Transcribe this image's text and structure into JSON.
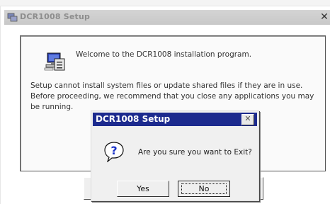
{
  "window": {
    "title": "DCR1008 Setup",
    "close_glyph": "✕"
  },
  "setup": {
    "welcome": "Welcome to the DCR1008 installation program.",
    "paragraph_line1": "Setup cannot install system files or update shared files if they are in use.",
    "paragraph_line2": "Before proceeding, we recommend that you close any applications you may",
    "paragraph_line3": "be running."
  },
  "dialog": {
    "title": "DCR1008 Setup",
    "close_glyph": "✕",
    "message": "Are you sure you want to Exit?",
    "yes_label": "Yes",
    "no_label": "No"
  },
  "colors": {
    "dialog_title_bg": "#1c2a8e",
    "question_icon": "#1a33c8"
  },
  "icons": [
    "setup-computer-icon",
    "question-icon",
    "close-icon"
  ]
}
